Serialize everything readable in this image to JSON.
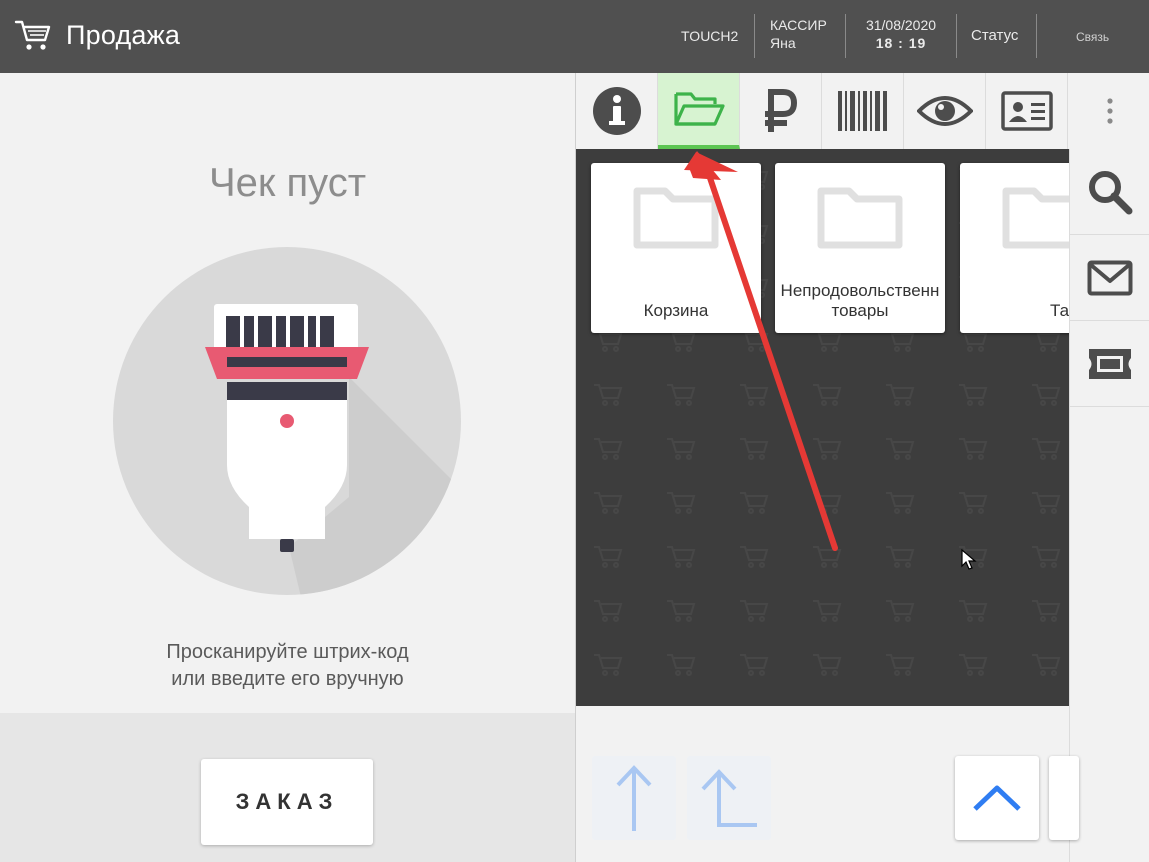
{
  "header": {
    "title": "Продажа",
    "terminal": "TOUCH2",
    "cashier_label": "КАССИР",
    "cashier_name": "Яна",
    "date": "31/08/2020",
    "time": "18 : 19",
    "status": "Статус",
    "connection": "Связь"
  },
  "receipt": {
    "empty_title": "Чек пуст",
    "hint_line1": "Просканируйте штрих-код",
    "hint_line2": "или введите его вручную",
    "order_button": "ЗАКАЗ"
  },
  "tabs": [
    {
      "icon": "info-icon",
      "active": false
    },
    {
      "icon": "folder-open-icon",
      "active": true
    },
    {
      "icon": "ruble-icon",
      "active": false
    },
    {
      "icon": "barcode-icon",
      "active": false
    },
    {
      "icon": "eye-icon",
      "active": false
    },
    {
      "icon": "id-card-icon",
      "active": false
    }
  ],
  "catalog": {
    "cards": [
      {
        "label": "Корзина"
      },
      {
        "label": "Непродовольственн\nтовары"
      },
      {
        "label": "Тара"
      }
    ]
  },
  "side_tools": [
    {
      "icon": "search-icon"
    },
    {
      "icon": "mail-icon"
    },
    {
      "icon": "ticket-icon"
    }
  ],
  "colors": {
    "header_bg": "#505050",
    "active_tab_bg": "#d7f3d1",
    "active_tab_accent": "#5cc552",
    "catalog_bg": "#3d3d3d",
    "scanner_accent": "#e85a72",
    "nav_arrow_blue": "#2f7df2",
    "annotation_red": "#e53935"
  }
}
